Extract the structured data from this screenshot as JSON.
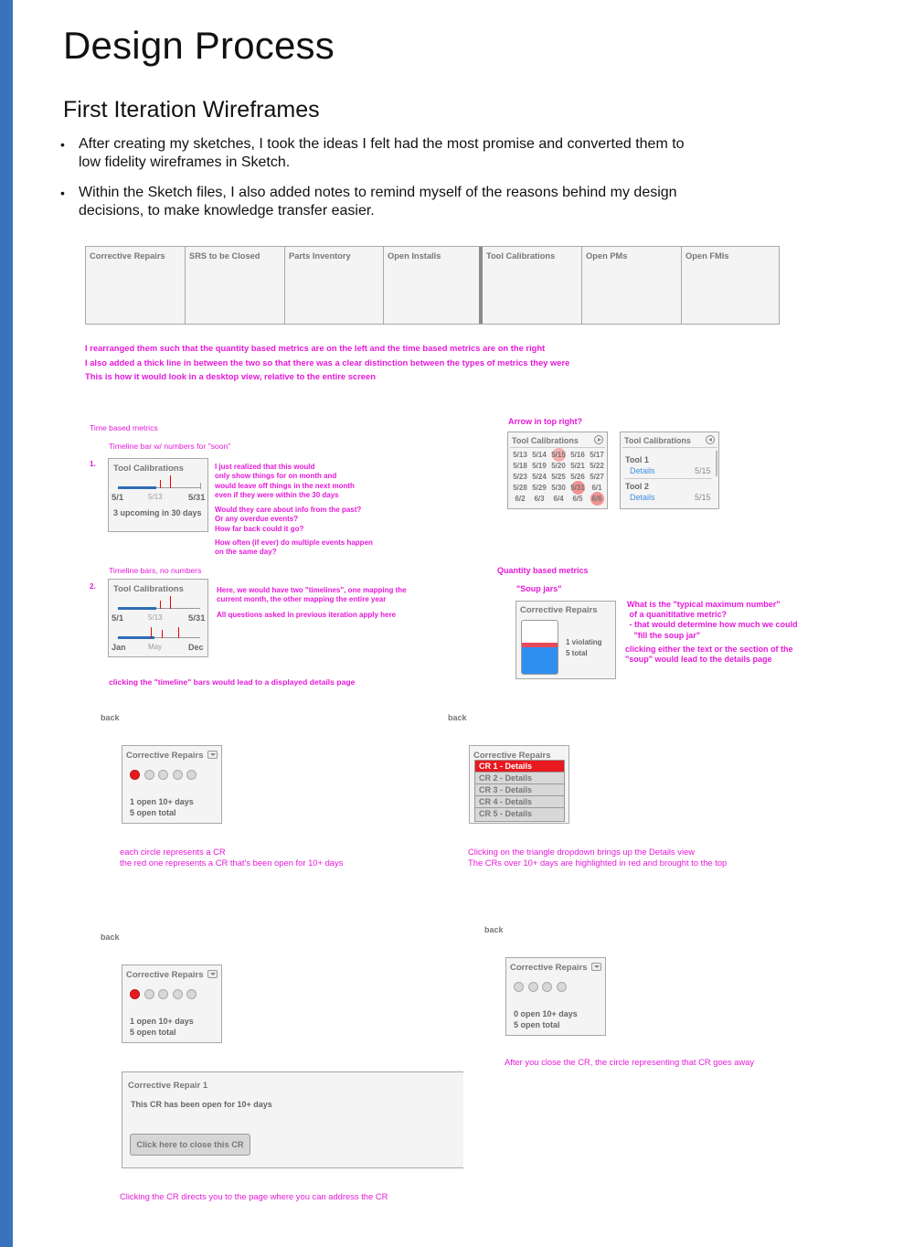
{
  "heading": "Design Process",
  "subheading": "First Iteration Wireframes",
  "bullets": [
    "After creating my sketches, I took the ideas I felt had the most promise and converted them to low fidelity wireframes in Sketch.",
    "Within the Sketch files, I also added notes to remind myself of the reasons behind my design decisions, to make knowledge transfer easier."
  ],
  "metrics_bar": [
    "Corrective Repairs",
    "SRS to be Closed",
    "Parts Inventory",
    "Open Installs",
    "Tool Calibrations",
    "Open PMs",
    "Open FMIs"
  ],
  "metrics_notes": "I rearranged them such that the quantity based metrics are on the left and the time based metrics are on the right\nI also added a thick line in between the two so that there was a clear distinction between the types of metrics they were\nThis is how it would look in a desktop view, relative to the entire screen",
  "time_section": {
    "label": "Time based metrics",
    "timeline1_label": "Timeline bar w/ numbers for \"soon\"",
    "num1": "1.",
    "card1": {
      "title": "Tool Calibrations",
      "start": "5/1",
      "mid": "5/13",
      "end": "5/31",
      "caption": "3 upcoming in 30 days"
    },
    "note1a": "I just realized that this would\nonly show things for on month and\nwould leave off things in the next month\neven if they were within the 30 days",
    "note1b": "Would they care about info from the past?\nOr any overdue events?\nHow far back could it go?",
    "note1c": "How often (if ever) do multiple events happen\non the same day?",
    "timeline2_label": "Timeline bars, no numbers",
    "num2": "2.",
    "card2": {
      "title": "Tool Calibrations",
      "start": "5/1",
      "mid": "5/13",
      "end": "5/31",
      "ystart": "Jan",
      "ymid": "May",
      "yend": "Dec"
    },
    "note2a": "Here, we would have two \"timelines\", one mapping the\ncurrent month, the other mapping the entire year",
    "note2b": "All questions asked in previous iteration apply here",
    "note2c": "clicking the \"timeline\" bars would lead to a displayed details page"
  },
  "calendar_section": {
    "label": "Arrow in top right?",
    "title": "Tool Calibrations",
    "dates": [
      [
        "5/13",
        "5/14",
        "5/15",
        "5/16",
        "5/17"
      ],
      [
        "5/18",
        "5/19",
        "5/20",
        "5/21",
        "5/22"
      ],
      [
        "5/23",
        "5/24",
        "5/25",
        "5/26",
        "5/27"
      ],
      [
        "5/28",
        "5/29",
        "5/30",
        "5/31",
        "6/1"
      ],
      [
        "6/2",
        "6/3",
        "6/4",
        "6/5",
        "6/6"
      ]
    ],
    "list_title": "Tool Calibrations",
    "tools": [
      {
        "name": "Tool 1",
        "link": "Details",
        "date": "5/15"
      },
      {
        "name": "Tool 2",
        "link": "Details",
        "date": "5/15"
      }
    ]
  },
  "quantity_section": {
    "label": "Quantity based metrics",
    "sub": "\"Soup jars\"",
    "title": "Corrective Repairs",
    "violating": "1 violating",
    "total": "5 total",
    "note_a": "What is the \"typical maximum number\"\n of a quanititative metric?\n - that would determine how much we could\n   \"fill the soup jar\"",
    "note_b": "clicking either the text or the section of the\n\"soup\" would lead to the details page"
  },
  "back_label": "back",
  "cr_card": {
    "title": "Corrective Repairs",
    "line1": "1 open 10+ days",
    "line2": "5 open total"
  },
  "cr_note": "each circle represents a CR\nthe red one represents a CR that's been open for 10+ days",
  "dropdown": {
    "title": "Corrective Repairs",
    "items": [
      "CR 1 - Details",
      "CR 2 - Details",
      "CR 3 - Details",
      "CR 4 - Details",
      "CR 5 - Details"
    ]
  },
  "dropdown_note": "Clicking on the triangle dropdown brings up the Details view\nThe CRs over 10+ days are highlighted in red and brought to the top",
  "cr_card_closed": {
    "title": "Corrective Repairs",
    "line1": "0 open 10+ days",
    "line2": "5 open total"
  },
  "closed_note": "After you close the CR, the circle representing that CR goes away",
  "detail_panel": {
    "title": "Corrective Repair 1",
    "text": "This CR has been open for 10+ days",
    "button": "Click here to close this CR"
  },
  "detail_note": "Clicking the CR directs you to the page where you can address the CR",
  "colors": {
    "accent": "#e619d9",
    "red": "#e8191f",
    "blue": "#2f7fdc",
    "sidebar": "#3a72bb"
  }
}
